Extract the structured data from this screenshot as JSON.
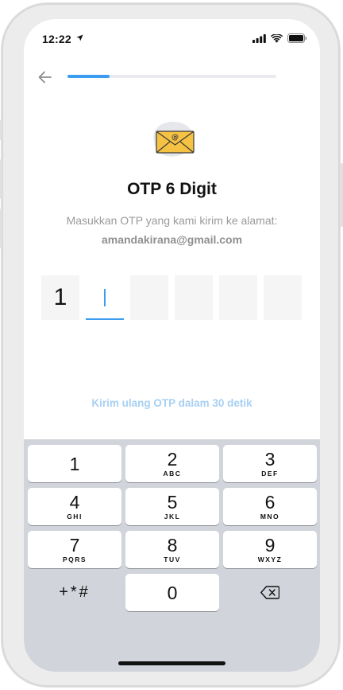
{
  "status_bar": {
    "time": "12:22"
  },
  "header": {
    "progress": 0.2
  },
  "main": {
    "title": "OTP 6 Digit",
    "subtitle": "Masukkan OTP yang kami kirim ke alamat:",
    "email": "amandakirana@gmail.com",
    "otp_digits": [
      "1",
      "",
      "",
      "",
      "",
      ""
    ],
    "resend_text": "Kirim ulang OTP dalam 30 detik"
  },
  "keypad": {
    "keys": [
      {
        "num": "1",
        "letters": ""
      },
      {
        "num": "2",
        "letters": "ABC"
      },
      {
        "num": "3",
        "letters": "DEF"
      },
      {
        "num": "4",
        "letters": "GHI"
      },
      {
        "num": "5",
        "letters": "JKL"
      },
      {
        "num": "6",
        "letters": "MNO"
      },
      {
        "num": "7",
        "letters": "PQRS"
      },
      {
        "num": "8",
        "letters": "TUV"
      },
      {
        "num": "9",
        "letters": "WXYZ"
      },
      {
        "num": "0",
        "letters": ""
      }
    ],
    "symbols_label": "+*#"
  },
  "colors": {
    "accent": "#3c9df0",
    "envelope": "#f6c244",
    "keypad_bg": "#d1d4da"
  },
  "icons": [
    "location-arrow-icon",
    "signal-icon",
    "wifi-icon",
    "battery-icon",
    "back-arrow-icon",
    "envelope-icon",
    "backspace-icon"
  ]
}
